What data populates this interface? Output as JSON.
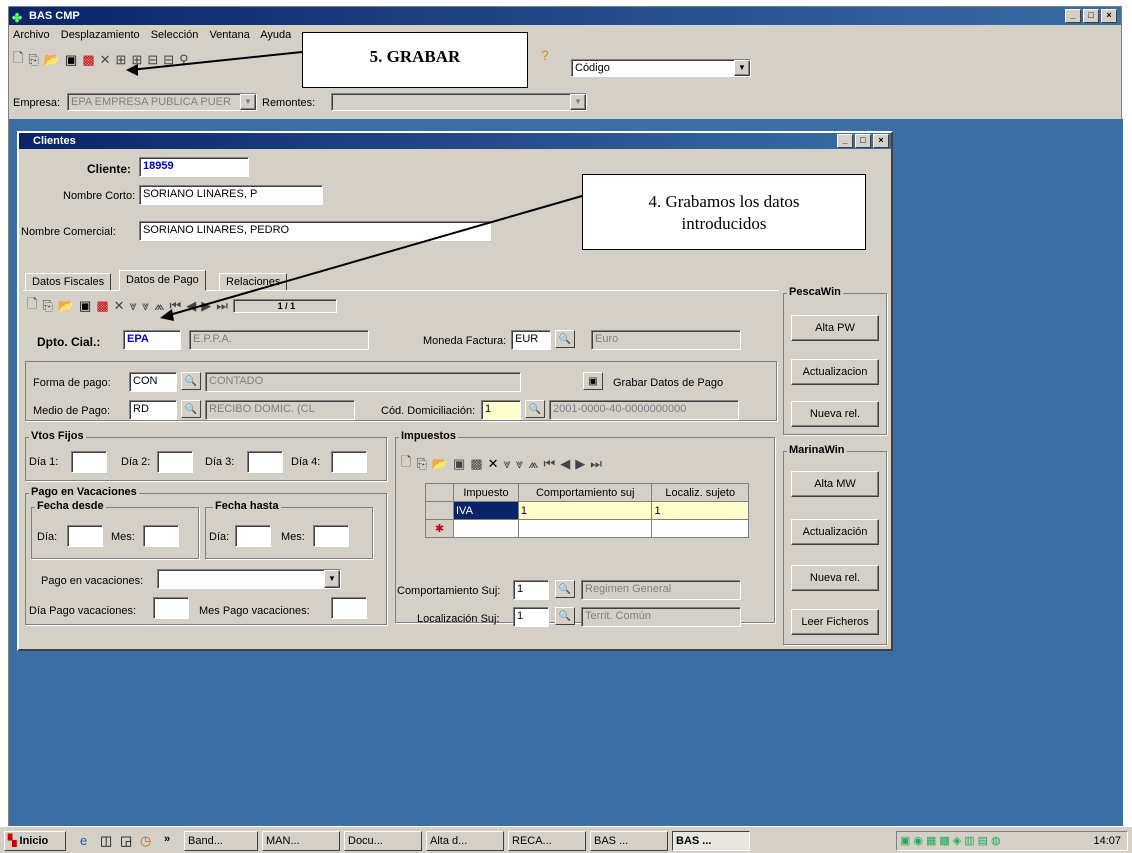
{
  "app": {
    "title": "BAS CMP"
  },
  "menu": [
    "Archivo",
    "Desplazamiento",
    "Selección",
    "Ventana",
    "Ayuda"
  ],
  "toolbar": {
    "codigo": "Código"
  },
  "empresa": {
    "label": "Empresa:",
    "value": "EPA  EMPRESA PUBLICA PUER",
    "remontes_label": "Remontes:"
  },
  "callouts": {
    "grabar": "5. GRABAR",
    "grabamos": "4. Grabamos los datos introducidos"
  },
  "clientes": {
    "title": "Clientes",
    "cliente_label": "Cliente:",
    "cliente_value": "18959",
    "nombre_corto_label": "Nombre Corto:",
    "nombre_corto_value": "SORIANO LINARES, P",
    "nombre_comercial_label": "Nombre Comercial:",
    "nombre_comercial_value": "SORIANO LINARES, PEDRO",
    "tabs": [
      "Datos Fiscales",
      "Datos de Pago",
      "Relaciones"
    ],
    "record": "1 / 1",
    "dpto_label": "Dpto. Cial.:",
    "dpto_value": "EPA",
    "dpto_desc": "E.P.P.A.",
    "moneda_label": "Moneda Factura:",
    "moneda_value": "EUR",
    "moneda_desc": "Euro",
    "forma_label": "Forma de pago:",
    "forma_value": "CON",
    "forma_desc": "CONTADO",
    "grabar_datos": "Grabar Datos de Pago",
    "medio_label": "Medio de Pago:",
    "medio_value": "RD",
    "medio_desc": "RECIBO DOMIC. (CL",
    "cod_dom_label": "Cód. Domiciliación:",
    "cod_dom_value": "1",
    "cod_dom_desc": "2001-0000-40-0000000000",
    "vtos_title": "Vtos Fijos",
    "dia1": "Día 1:",
    "dia2": "Día 2:",
    "dia3": "Día 3:",
    "dia4": "Día 4:",
    "vac_title": "Pago en Vacaciones",
    "fecha_desde": "Fecha desde",
    "fecha_hasta": "Fecha hasta",
    "dia": "Día:",
    "mes": "Mes:",
    "pago_vac_label": "Pago en vacaciones:",
    "dia_pago_vac": "Día Pago vacaciones:",
    "mes_pago_vac": "Mes Pago vacaciones:",
    "impuestos_title": "Impuestos",
    "grid_headers": [
      "Impuesto",
      "Comportamiento suj",
      "Localiz. sujeto"
    ],
    "grid_row": [
      "IVA",
      "1",
      "1"
    ],
    "comp_label": "Comportamiento Suj:",
    "comp_value": "1",
    "comp_desc": "Regimen General",
    "loc_label": "Localización Suj:",
    "loc_value": "1",
    "loc_desc": "Territ. Común",
    "pescawin": "PescaWin",
    "alta_pw": "Alta PW",
    "actualizacion": "Actualizacion",
    "nueva_rel": "Nueva rel.",
    "marinawin": "MarinaWin",
    "alta_mw": "Alta MW",
    "actualizacion2": "Actualización",
    "nueva_rel2": "Nueva rel.",
    "leer": "Leer Ficheros"
  },
  "taskbar": {
    "start": "Inicio",
    "items": [
      "Band...",
      "MAN...",
      "Docu...",
      "Alta d...",
      "RECA...",
      "BAS ...",
      "BAS ..."
    ],
    "clock": "14:07"
  }
}
